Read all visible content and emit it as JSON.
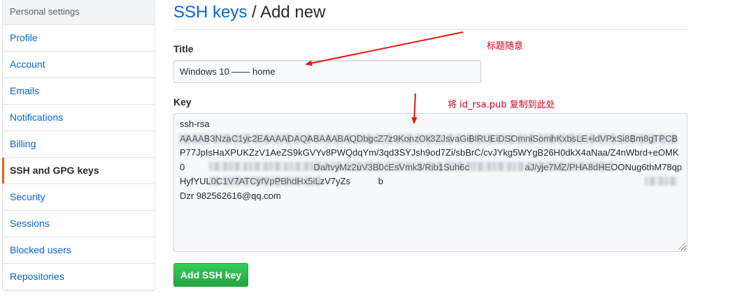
{
  "sidebar": {
    "header": "Personal settings",
    "items": [
      {
        "label": "Profile"
      },
      {
        "label": "Account"
      },
      {
        "label": "Emails"
      },
      {
        "label": "Notifications"
      },
      {
        "label": "Billing"
      },
      {
        "label": "SSH and GPG keys",
        "selected": true
      },
      {
        "label": "Security"
      },
      {
        "label": "Sessions"
      },
      {
        "label": "Blocked users"
      },
      {
        "label": "Repositories"
      }
    ]
  },
  "main": {
    "breadcrumb_link": "SSH keys",
    "breadcrumb_separator": " / ",
    "page_title": "Add new",
    "title_label": "Title",
    "title_value": "Windows 10 —— home",
    "key_label": "Key",
    "key_value": "ssh-rsa\nAAAAB3NzaC1yc2EAAAADAQABAAABAQDbgcZ7z9KonzOk3ZJsvaGiBlRUEiDSOmniSomhKxbsLE+idVPxSi8Bm8gTPCBP77JpIsHaXPUKZzV1AeZS9kGVYv8PWQdqYm/3qd3SYJsh9od7Zi/sbBrC/cvJYkg5WYgB26H0dkX4aNaa/Z4nWbrd+eOMK0                                                   Da/tvyMz2uV3B0cEsVmk3/Rib1Suh6c                      aJ/yje7MZ/PHA8dHEOONug6thM78qpHyfYUL0C1V7ATCyfVpPBhdHx5iLzV7yZs           b\nDzr 982562616@qq.com",
    "submit_label": "Add SSH key"
  },
  "annotations": {
    "title_note": "标题随意",
    "key_note": "将 id_rsa.pub 复制到此处",
    "color": "#d0021b"
  }
}
